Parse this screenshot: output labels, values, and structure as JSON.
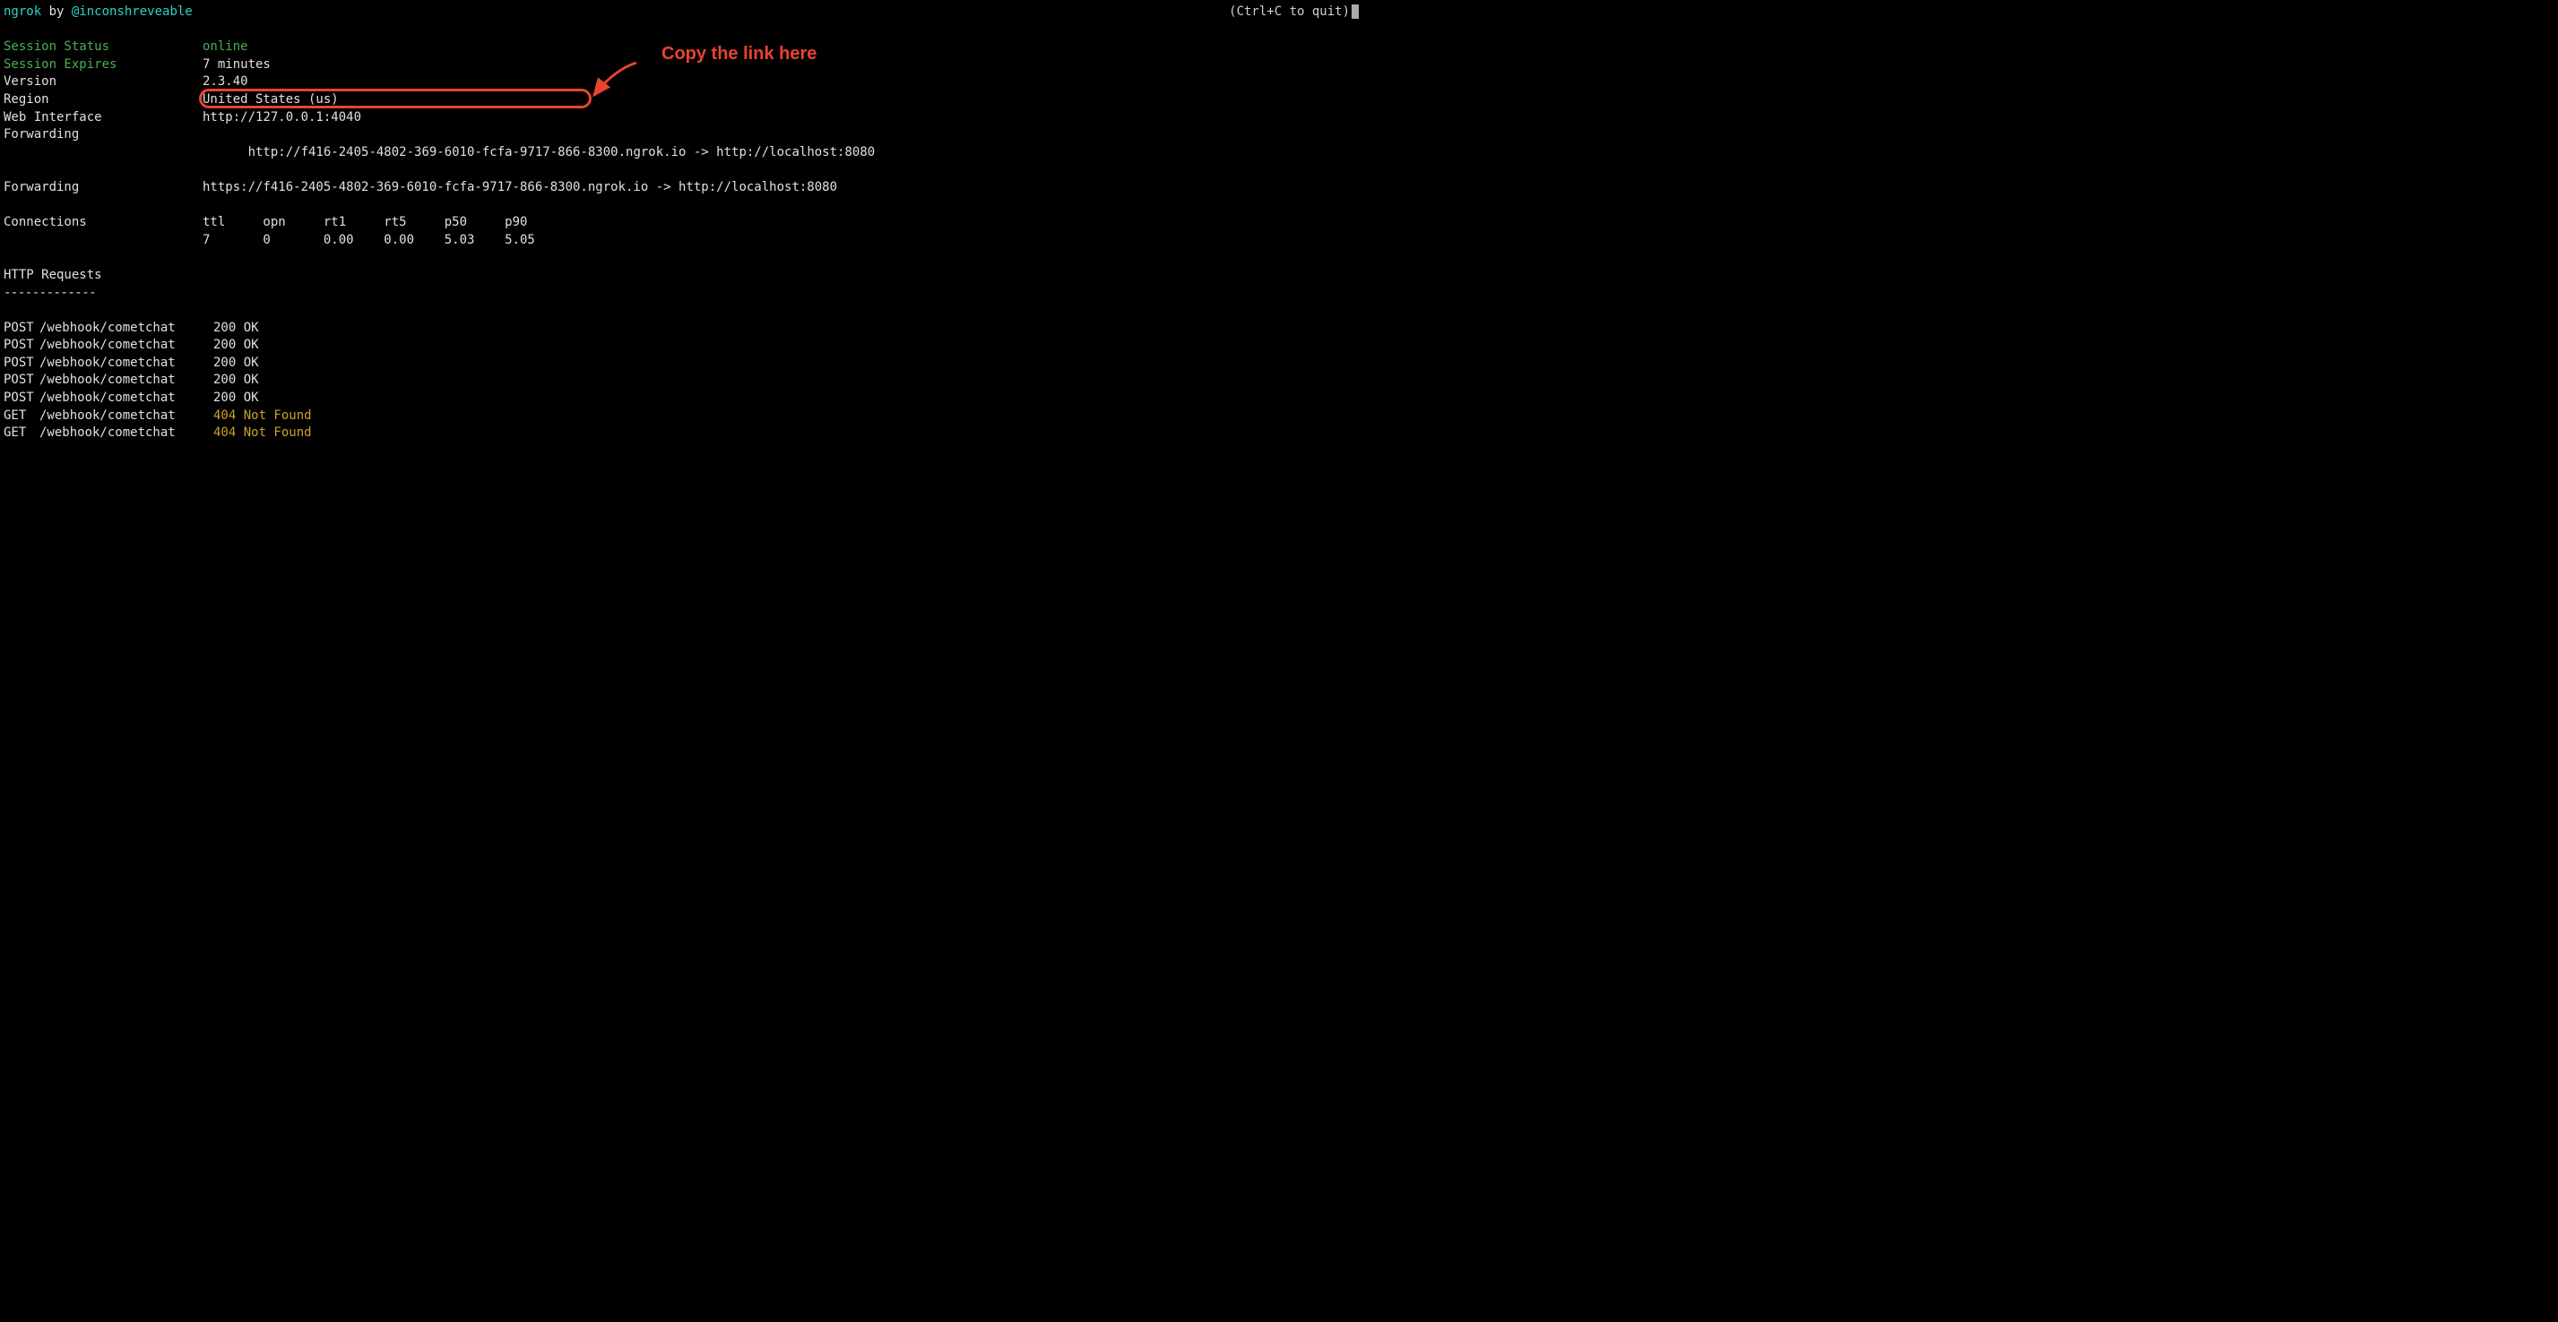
{
  "header": {
    "app_name": "ngrok",
    "by": " by ",
    "author": "@inconshreveable",
    "quit_hint": "(Ctrl+C to quit)"
  },
  "session": {
    "status_label": "Session Status",
    "status_value": "online",
    "expires_label": "Session Expires",
    "expires_value": "7 minutes"
  },
  "info": {
    "version_label": "Version",
    "version_value": "2.3.40",
    "region_label": "Region",
    "region_value": "United States (us)",
    "web_interface_label": "Web Interface",
    "web_interface_value": "http://127.0.0.1:4040",
    "forwarding1_label": "Forwarding",
    "forwarding1_url": "http://f416-2405-4802-369-6010-fcfa-9717-866-8300.ngrok.io",
    "forwarding1_arrow": " -> http://localhost:8080",
    "forwarding2_label": "Forwarding",
    "forwarding2_value": "https://f416-2405-4802-369-6010-fcfa-9717-866-8300.ngrok.io -> http://localhost:8080"
  },
  "connections": {
    "label": "Connections",
    "header": "ttl     opn     rt1     rt5     p50     p90",
    "values": "7       0       0.00    0.00    5.03    5.05"
  },
  "requests": {
    "title": "HTTP Requests",
    "divider": "-------------",
    "rows": [
      {
        "method": "POST",
        "path": "/webhook/cometchat",
        "status": "200 OK",
        "status_class": "status-ok"
      },
      {
        "method": "POST",
        "path": "/webhook/cometchat",
        "status": "200 OK",
        "status_class": "status-ok"
      },
      {
        "method": "POST",
        "path": "/webhook/cometchat",
        "status": "200 OK",
        "status_class": "status-ok"
      },
      {
        "method": "POST",
        "path": "/webhook/cometchat",
        "status": "200 OK",
        "status_class": "status-ok"
      },
      {
        "method": "POST",
        "path": "/webhook/cometchat",
        "status": "200 OK",
        "status_class": "status-ok"
      },
      {
        "method": "GET",
        "path": "/webhook/cometchat",
        "status": "404 Not Found",
        "status_class": "status-notfound"
      },
      {
        "method": "GET",
        "path": "/webhook/cometchat",
        "status": "404 Not Found",
        "status_class": "status-notfound"
      }
    ]
  },
  "annotation": {
    "text": "Copy the link here"
  }
}
